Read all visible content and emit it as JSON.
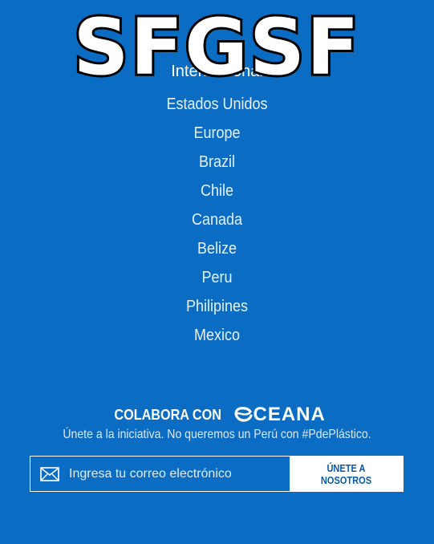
{
  "watermark": {
    "text": "SFGSF"
  },
  "countries": {
    "partial": "Internacional",
    "items": [
      "Estados Unidos",
      "Europe",
      "Brazil",
      "Chile",
      "Canada",
      "Belize",
      "Peru",
      "Philipines",
      "Mexico"
    ]
  },
  "collaborate": {
    "label": "COLABORA CON",
    "brand": "CEANA",
    "subtitle": "Únete a la iniciativa. No queremos un Perú con #PdePlástico."
  },
  "signup": {
    "email_placeholder": "Ingresa tu correo electrónico",
    "button_label": "ÚNETE A NOSOTROS"
  },
  "colors": {
    "background": "#0a6cc3",
    "button_text": "#0a5aa5"
  }
}
